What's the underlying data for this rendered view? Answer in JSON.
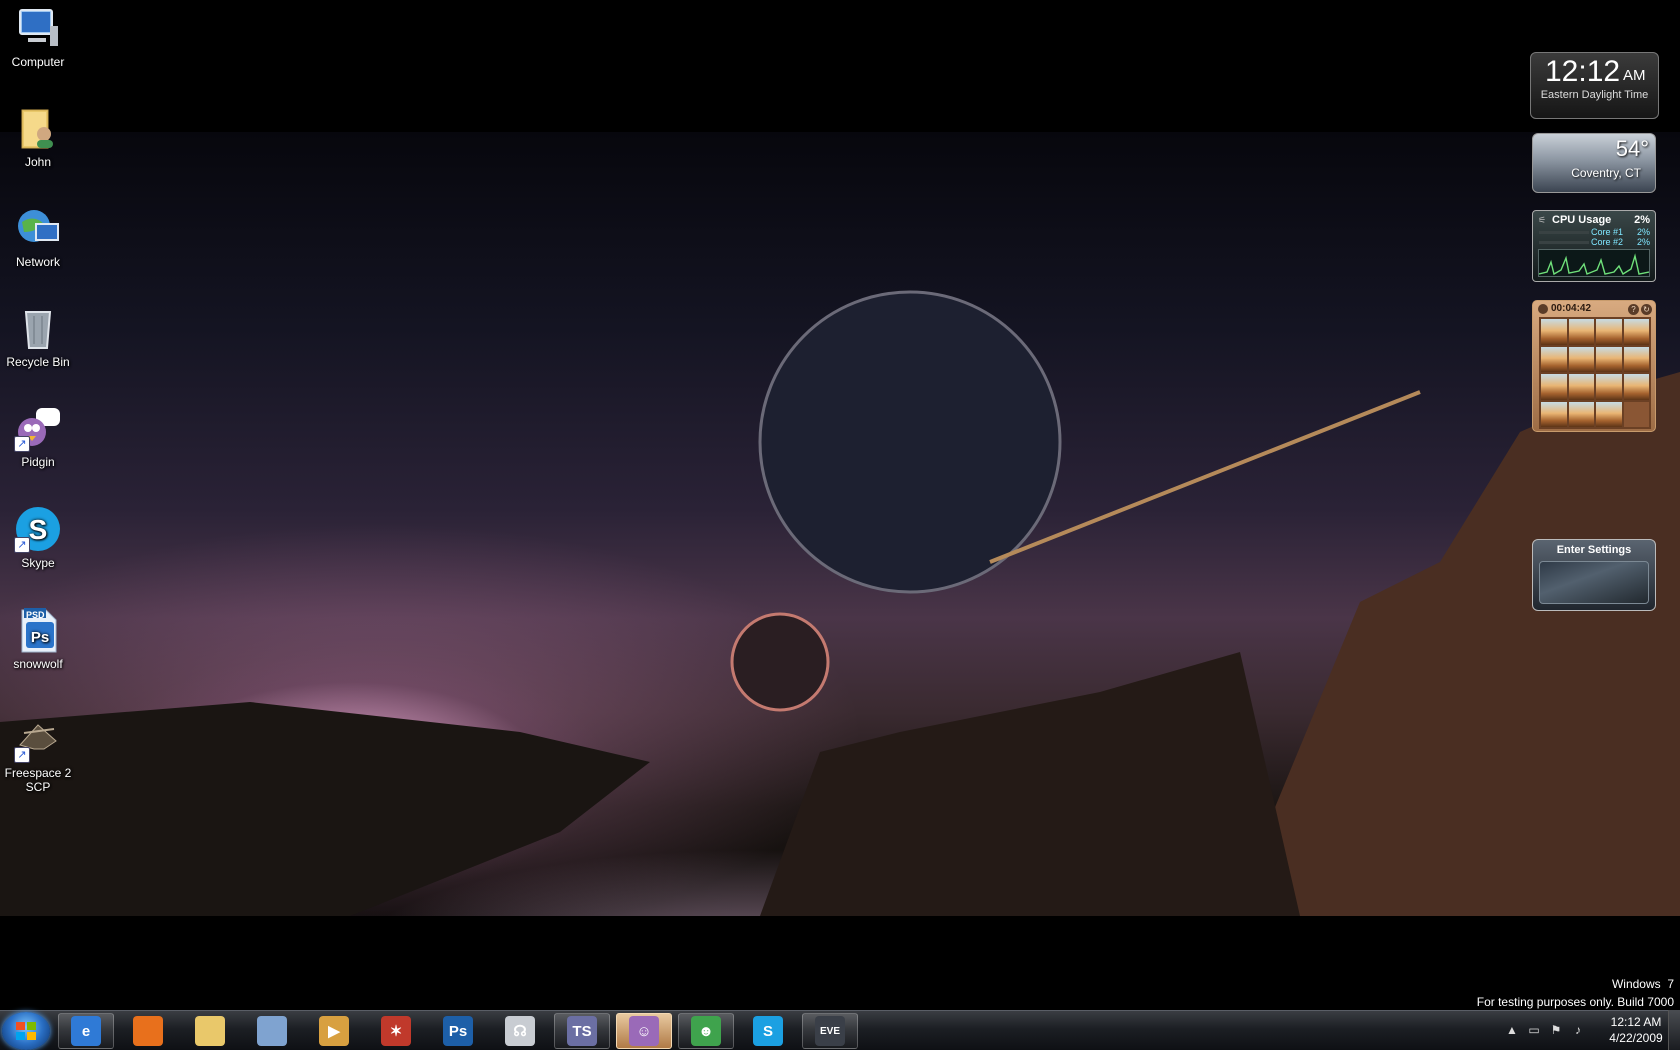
{
  "desktop_icons": [
    {
      "id": "computer",
      "label": "Computer"
    },
    {
      "id": "john",
      "label": "John"
    },
    {
      "id": "network",
      "label": "Network"
    },
    {
      "id": "recycle-bin",
      "label": "Recycle Bin"
    },
    {
      "id": "pidgin",
      "label": "Pidgin"
    },
    {
      "id": "skype",
      "label": "Skype"
    },
    {
      "id": "snowwolf",
      "label": "snowwolf",
      "badge": "PSD"
    },
    {
      "id": "freespace",
      "label": "Freespace 2 SCP"
    }
  ],
  "clock_gadget": {
    "time": "12:12",
    "ampm": "AM",
    "zone": "Eastern Daylight Time"
  },
  "weather_gadget": {
    "temperature": "54°",
    "location": "Coventry, CT"
  },
  "cpu_gadget": {
    "title": "CPU Usage",
    "total": "2%",
    "cores": [
      {
        "label": "Core #1",
        "value": "2%"
      },
      {
        "label": "Core #2",
        "value": "2%"
      }
    ]
  },
  "puzzle_gadget": {
    "timer": "00:04:42",
    "help_icon": "?",
    "shuffle_icon": "↻"
  },
  "settings_gadget": {
    "label": "Enter Settings"
  },
  "watermark": {
    "line1": "Windows  7",
    "line2": "For testing purposes only. Build 7000"
  },
  "taskbar": {
    "items": [
      {
        "icon": "internet-explorer-icon",
        "glyph": "e",
        "color": "#2f7ad6",
        "state": "open"
      },
      {
        "icon": "firefox-icon",
        "glyph": "",
        "color": "#e8701c",
        "state": "pinned"
      },
      {
        "icon": "explorer-folder-icon",
        "glyph": "",
        "color": "#e9c86a",
        "state": "pinned"
      },
      {
        "icon": "system-tool-icon",
        "glyph": "",
        "color": "#7fa3d0",
        "state": "pinned"
      },
      {
        "icon": "media-player-icon",
        "glyph": "▶",
        "color": "#d8a040",
        "state": "pinned"
      },
      {
        "icon": "star-app-icon",
        "glyph": "✶",
        "color": "#c0392b",
        "state": "pinned"
      },
      {
        "icon": "photoshop-icon",
        "glyph": "Ps",
        "color": "#1d5fa8",
        "state": "pinned"
      },
      {
        "icon": "headset-icon",
        "glyph": "☊",
        "color": "#c8ccd2",
        "state": "pinned"
      },
      {
        "icon": "teamspeak-icon",
        "glyph": "TS",
        "color": "#6b6fa3",
        "state": "open"
      },
      {
        "icon": "pidgin-icon",
        "glyph": "☺",
        "color": "#9a6ab8",
        "state": "active"
      },
      {
        "icon": "messenger-icon",
        "glyph": "☻",
        "color": "#3fa34d",
        "state": "open"
      },
      {
        "icon": "skype-icon",
        "glyph": "S",
        "color": "#1ba0e2",
        "state": "pinned"
      },
      {
        "icon": "eve-online-icon",
        "glyph": "EVE",
        "color": "#3a3f48",
        "state": "open"
      }
    ]
  },
  "tray": {
    "time": "12:12 AM",
    "date": "4/22/2009"
  }
}
